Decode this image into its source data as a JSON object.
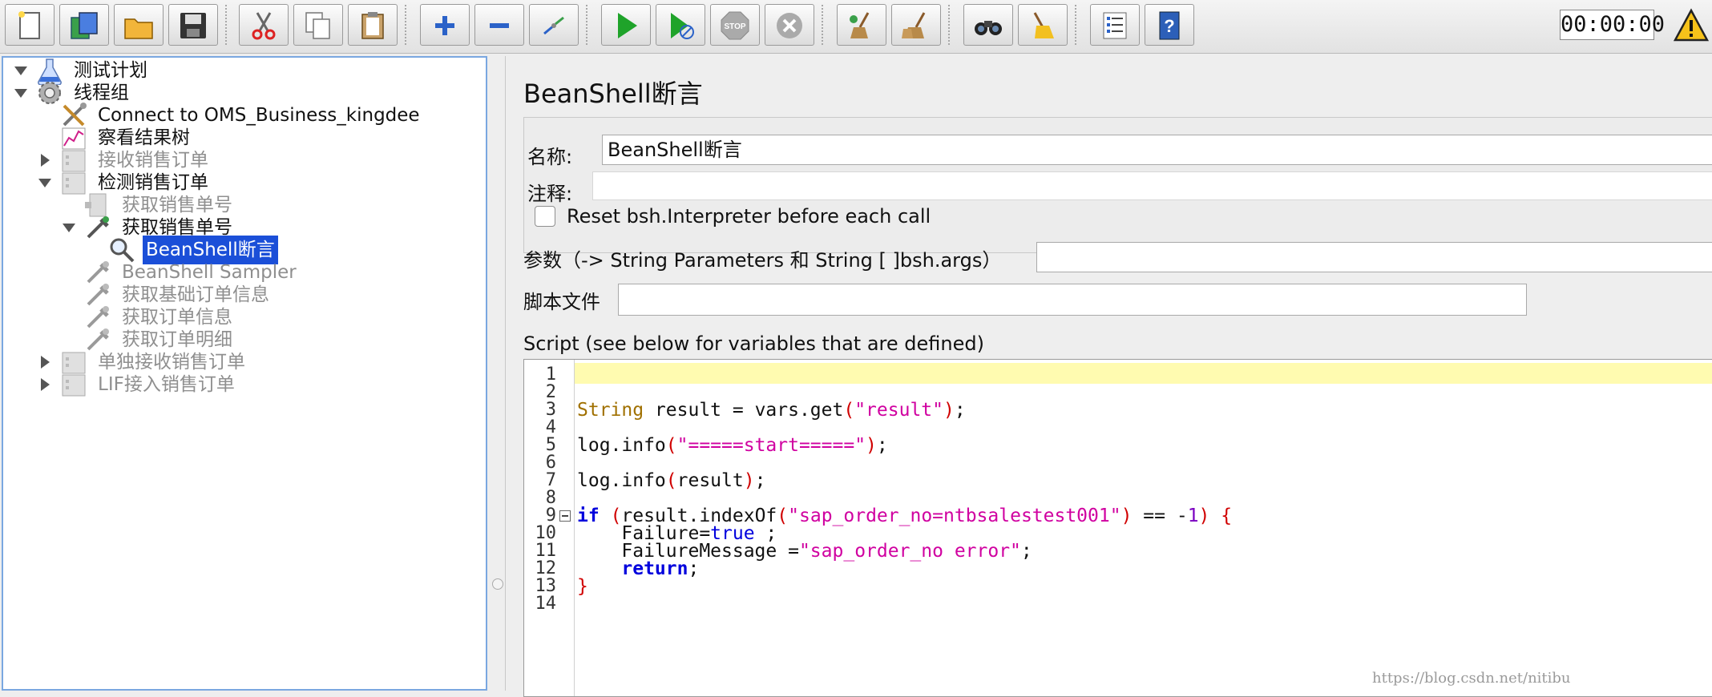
{
  "toolbar": {
    "buttons": [
      {
        "name": "new-icon"
      },
      {
        "name": "templates-icon"
      },
      {
        "name": "open-icon"
      },
      {
        "name": "save-icon"
      },
      {
        "name": "cut-icon"
      },
      {
        "name": "copy-icon"
      },
      {
        "name": "paste-icon"
      },
      {
        "name": "expand-icon"
      },
      {
        "name": "collapse-icon"
      },
      {
        "name": "toggle-icon"
      },
      {
        "name": "start-icon"
      },
      {
        "name": "start-no-pause-icon"
      },
      {
        "name": "stop-icon"
      },
      {
        "name": "shutdown-icon"
      },
      {
        "name": "clear-icon"
      },
      {
        "name": "clear-all-icon"
      },
      {
        "name": "search-icon"
      },
      {
        "name": "reset-search-icon"
      },
      {
        "name": "function-helper-icon"
      },
      {
        "name": "help-icon"
      }
    ],
    "timer": "00:00:00",
    "warning_icon": "warning-icon"
  },
  "tree": {
    "nodes": [
      {
        "label": "测试计划",
        "icon": "flask-icon",
        "state": "normal",
        "toggle": "expanded"
      },
      {
        "label": "线程组",
        "icon": "gear-icon",
        "state": "normal",
        "toggle": "expanded"
      },
      {
        "label": "Connect to OMS_Business_kingdee",
        "icon": "wrench-icon",
        "state": "normal",
        "toggle": "none"
      },
      {
        "label": "察看结果树",
        "icon": "graph-icon",
        "state": "normal",
        "toggle": "none"
      },
      {
        "label": "接收销售订单",
        "icon": "controller-icon",
        "state": "disabled",
        "toggle": "collapsed"
      },
      {
        "label": "检测销售订单",
        "icon": "controller-icon",
        "state": "normal",
        "toggle": "expanded"
      },
      {
        "label": "获取销售单号",
        "icon": "sampler-icon",
        "state": "disabled",
        "toggle": "none"
      },
      {
        "label": "获取销售单号",
        "icon": "pipette-icon",
        "state": "normal",
        "toggle": "expanded"
      },
      {
        "label": "BeanShell断言",
        "icon": "magnifier-icon",
        "state": "selected",
        "toggle": "none"
      },
      {
        "label": "BeanShell Sampler",
        "icon": "pipette-icon",
        "state": "disabled",
        "toggle": "none"
      },
      {
        "label": "获取基础订单信息",
        "icon": "pipette-icon",
        "state": "disabled",
        "toggle": "none"
      },
      {
        "label": "获取订单信息",
        "icon": "pipette-icon",
        "state": "disabled",
        "toggle": "none"
      },
      {
        "label": "获取订单明细",
        "icon": "pipette-icon",
        "state": "disabled",
        "toggle": "none"
      },
      {
        "label": "单独接收销售订单",
        "icon": "controller-icon",
        "state": "disabled",
        "toggle": "collapsed"
      },
      {
        "label": "LIF接入销售订单",
        "icon": "controller-icon",
        "state": "disabled",
        "toggle": "collapsed"
      }
    ]
  },
  "panel": {
    "title": "BeanShell断言",
    "name_label": "名称:",
    "name_value": "BeanShell断言",
    "comment_label": "注释:",
    "comment_value": "",
    "reset_label": "Reset bsh.Interpreter before each call",
    "reset_checked": false,
    "params_label": "参数（-> String Parameters 和 String [ ]bsh.args）",
    "params_value": "",
    "script_file_label": "脚本文件",
    "script_file_value": "",
    "script_label": "Script (see below for variables that are defined)",
    "code_lines": [
      {
        "n": "1",
        "html": ""
      },
      {
        "n": "2",
        "html": ""
      },
      {
        "n": "3",
        "html": "<span class=\"kw-type\">String</span> result = vars.get<span class=\"paren\">(</span><span class=\"str\">\"result\"</span><span class=\"paren\">)</span>;"
      },
      {
        "n": "4",
        "html": ""
      },
      {
        "n": "5",
        "html": "log.info<span class=\"paren\">(</span><span class=\"str\">\"=====start=====\"</span><span class=\"paren\">)</span>;"
      },
      {
        "n": "6",
        "html": ""
      },
      {
        "n": "7",
        "html": "log.info<span class=\"paren\">(</span>result<span class=\"paren\">)</span>;"
      },
      {
        "n": "8",
        "html": ""
      },
      {
        "n": "9",
        "html": "<span class=\"kw\">if</span> <span class=\"paren\">(</span>result.indexOf<span class=\"paren\">(</span><span class=\"str\">\"sap_order_no=ntbsalestest001\"</span><span class=\"paren\">)</span> == -<span class=\"num-lit\">1</span><span class=\"paren\">)</span> <span class=\"paren\">{</span>",
        "fold": true
      },
      {
        "n": "10",
        "html": "    Failure=<span class=\"kw\" style=\"font-weight:normal\">true</span> ;"
      },
      {
        "n": "11",
        "html": "    FailureMessage =<span class=\"str\">\"sap_order_no error\"</span>;"
      },
      {
        "n": "12",
        "html": "    <span class=\"kw\">return</span>;"
      },
      {
        "n": "13",
        "html": "<span class=\"paren\">}</span>"
      },
      {
        "n": "14",
        "html": ""
      }
    ]
  },
  "watermark": "https://blog.csdn.net/nitibu"
}
